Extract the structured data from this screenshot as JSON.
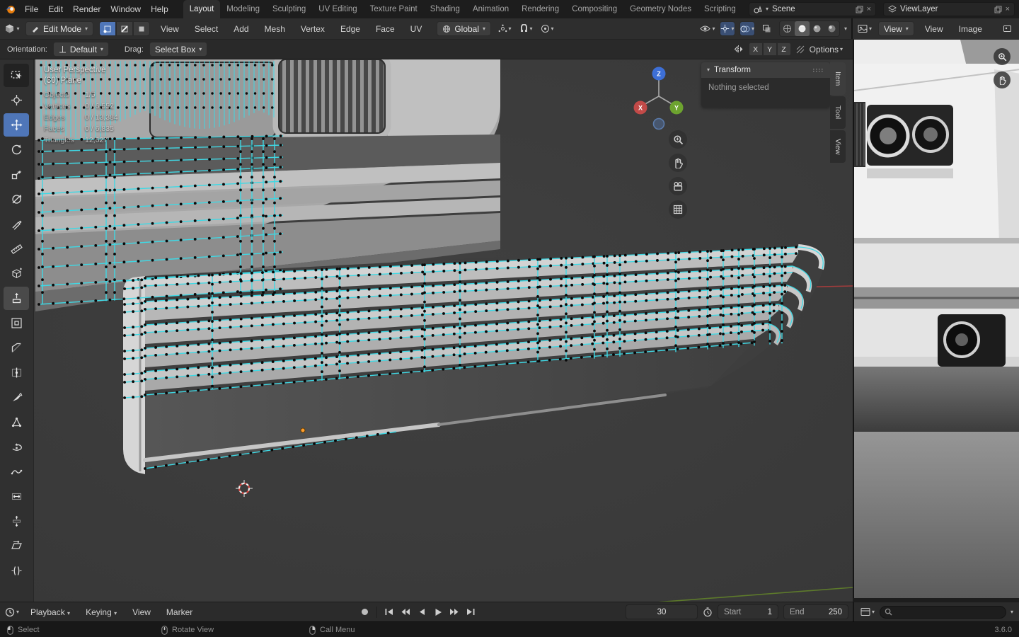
{
  "glyphs": {
    "chevron_down": "▾",
    "close": "×"
  },
  "topbar": {
    "menus": [
      "File",
      "Edit",
      "Render",
      "Window",
      "Help"
    ],
    "workspaces": [
      "Layout",
      "Modeling",
      "Sculpting",
      "UV Editing",
      "Texture Paint",
      "Shading",
      "Animation",
      "Rendering",
      "Compositing",
      "Geometry Nodes",
      "Scripting"
    ],
    "active_workspace": "Layout",
    "scene_name": "Scene",
    "view_layer_name": "ViewLayer"
  },
  "viewport_header": {
    "mode": "Edit Mode",
    "menus": [
      "View",
      "Select",
      "Add",
      "Mesh",
      "Vertex",
      "Edge",
      "Face",
      "UV"
    ],
    "orientation": "Global"
  },
  "image_editor_header": {
    "mode": "View",
    "menus": [
      "View",
      "Image"
    ]
  },
  "tool_settings": {
    "orientation_label": "Orientation:",
    "orientation_value": "Default",
    "drag_label": "Drag:",
    "drag_value": "Select Box",
    "axes": [
      "X",
      "Y",
      "Z"
    ],
    "options_label": "Options"
  },
  "viewport": {
    "overlay": {
      "view_name": "User Perspective",
      "object_name": "(30) Plane",
      "stats": {
        "rows": [
          {
            "label": "Objects",
            "value": "1/5"
          },
          {
            "label": "Vertices",
            "value": "0 / 6,552"
          },
          {
            "label": "Edges",
            "value": "0 / 13,384"
          },
          {
            "label": "Faces",
            "value": "0 / 6,835"
          },
          {
            "label": "Triangles",
            "value": "12,627"
          }
        ]
      }
    },
    "gizmo": {
      "x": "X",
      "y": "Y",
      "z": "Z"
    },
    "tools": [
      "select-box",
      "cursor",
      "move",
      "rotate",
      "scale",
      "transform",
      "annotate",
      "measure",
      "add-cube",
      "extrude-region",
      "inset-faces",
      "bevel",
      "loop-cut",
      "knife",
      "poly-build",
      "spin",
      "smooth",
      "edge-slide",
      "shrink-fatten",
      "shear",
      "rip-region"
    ]
  },
  "sidebar": {
    "panel_title": "Transform",
    "empty_text": "Nothing selected",
    "tabs": [
      "Item",
      "Tool",
      "View"
    ]
  },
  "timeline": {
    "playback_label": "Playback",
    "keying_label": "Keying",
    "menus": [
      "View",
      "Marker"
    ],
    "current_frame": "30",
    "start_label": "Start",
    "start_value": "1",
    "end_label": "End",
    "end_value": "250"
  },
  "statusbar": {
    "hints": [
      "Select",
      "Rotate View",
      "Call Menu"
    ],
    "version": "3.6.0"
  },
  "colors": {
    "selection_edge": "#3fd8e4",
    "vertex": "#0a0a0a",
    "axis_x": "#a33c3c",
    "axis_y": "#5d7a2b",
    "axis_z": "#3d6fd6",
    "active_tool": "#4f76b8"
  }
}
